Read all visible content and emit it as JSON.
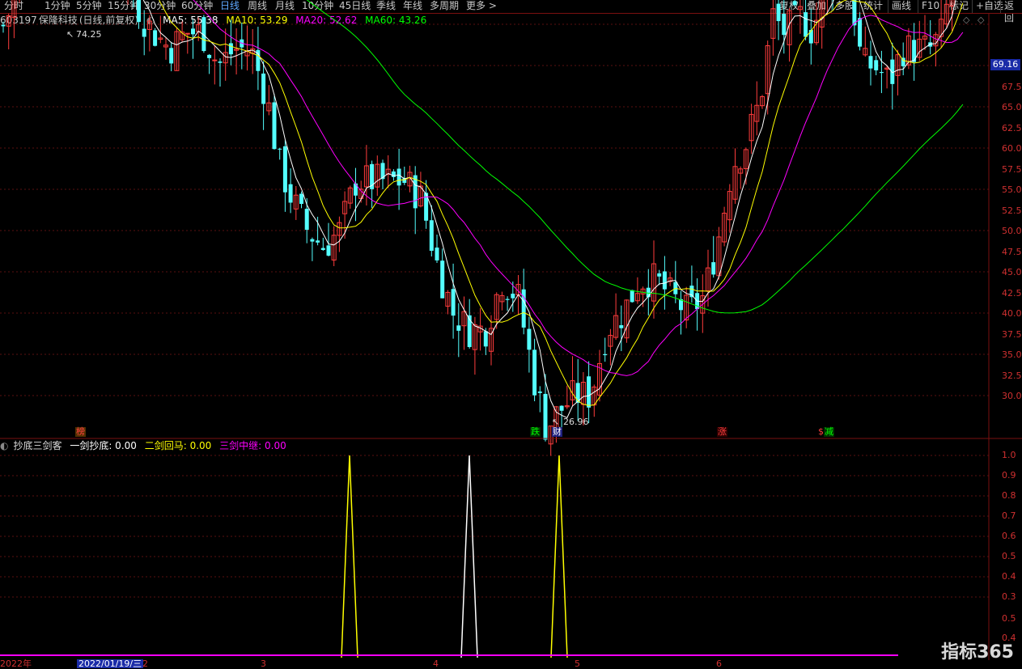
{
  "toolbar": {
    "left_items": [
      "分时",
      "1分钟",
      "5分钟",
      "15分钟",
      "30分钟",
      "60分钟",
      "日线",
      "周线",
      "月线",
      "10分钟",
      "45日线",
      "季线",
      "年线",
      "多周期",
      "更多 >"
    ],
    "active": "日线",
    "right_items": [
      "复权",
      "叠加",
      "多股",
      "统计",
      "画线",
      "F10",
      "标记",
      "+自选",
      "返回"
    ]
  },
  "stock": {
    "code": "603197",
    "name": "保隆科技",
    "mode": "(日线,前复权)"
  },
  "ma": [
    {
      "label": "MA5: 55.38",
      "color": "#ffffff"
    },
    {
      "label": "MA10: 53.29",
      "color": "#ffff00"
    },
    {
      "label": "MA20: 52.62",
      "color": "#ff00ff"
    },
    {
      "label": "MA60: 43.26",
      "color": "#00ff00"
    }
  ],
  "price_axis": [
    "67.5",
    "65.0",
    "62.5",
    "60.0",
    "57.5",
    "55.0",
    "52.5",
    "50.0",
    "47.5",
    "45.0",
    "42.5",
    "40.0",
    "37.5",
    "35.0",
    "32.5",
    "30.0"
  ],
  "current_price_tag": "69.16",
  "high_label": "74.25",
  "low_label": "26.96",
  "markers": [
    {
      "text": "榜",
      "color": "#ff4040",
      "bg": "#503000"
    },
    {
      "text": "跌",
      "color": "#00ff00",
      "bg": "#003000"
    },
    {
      "text": "财",
      "color": "#ffffff",
      "bg": "#202080"
    },
    {
      "text": "涨",
      "color": "#ff4040",
      "bg": "#300000"
    },
    {
      "text": "$",
      "color": "#ff4040",
      "bg": "#000000"
    },
    {
      "text": "减",
      "color": "#00ff00",
      "bg": "#003000"
    }
  ],
  "indicator": {
    "name": "抄底三剑客",
    "series": [
      {
        "label": "一剑抄底: 0.00",
        "color": "#ffffff"
      },
      {
        "label": "二剑回马: 0.00",
        "color": "#ffff00"
      },
      {
        "label": "三剑中继: 0.00",
        "color": "#ff00ff"
      }
    ],
    "axis": [
      "1.0",
      "0.9",
      "0.8",
      "0.7",
      "0.6",
      "0.5",
      "0.4",
      "0.3",
      "0.5",
      "0.4"
    ]
  },
  "dates": {
    "first": "2022年",
    "selected": "2022/01/19/三",
    "months": [
      "2",
      "3",
      "4",
      "5",
      "6"
    ]
  },
  "watermark": "指标365",
  "chart_data": {
    "type": "candlestick",
    "ylim": [
      25,
      75
    ],
    "ma_values": {
      "MA5": 55.38,
      "MA10": 53.29,
      "MA20": 52.62,
      "MA60": 43.26
    },
    "high": 74.25,
    "low": 26.96,
    "indicator_spikes": [
      {
        "series": "二剑回马",
        "value": 1.0
      },
      {
        "series": "一剑抄底",
        "value": 1.0
      },
      {
        "series": "二剑回马",
        "value": 1.0
      }
    ]
  }
}
